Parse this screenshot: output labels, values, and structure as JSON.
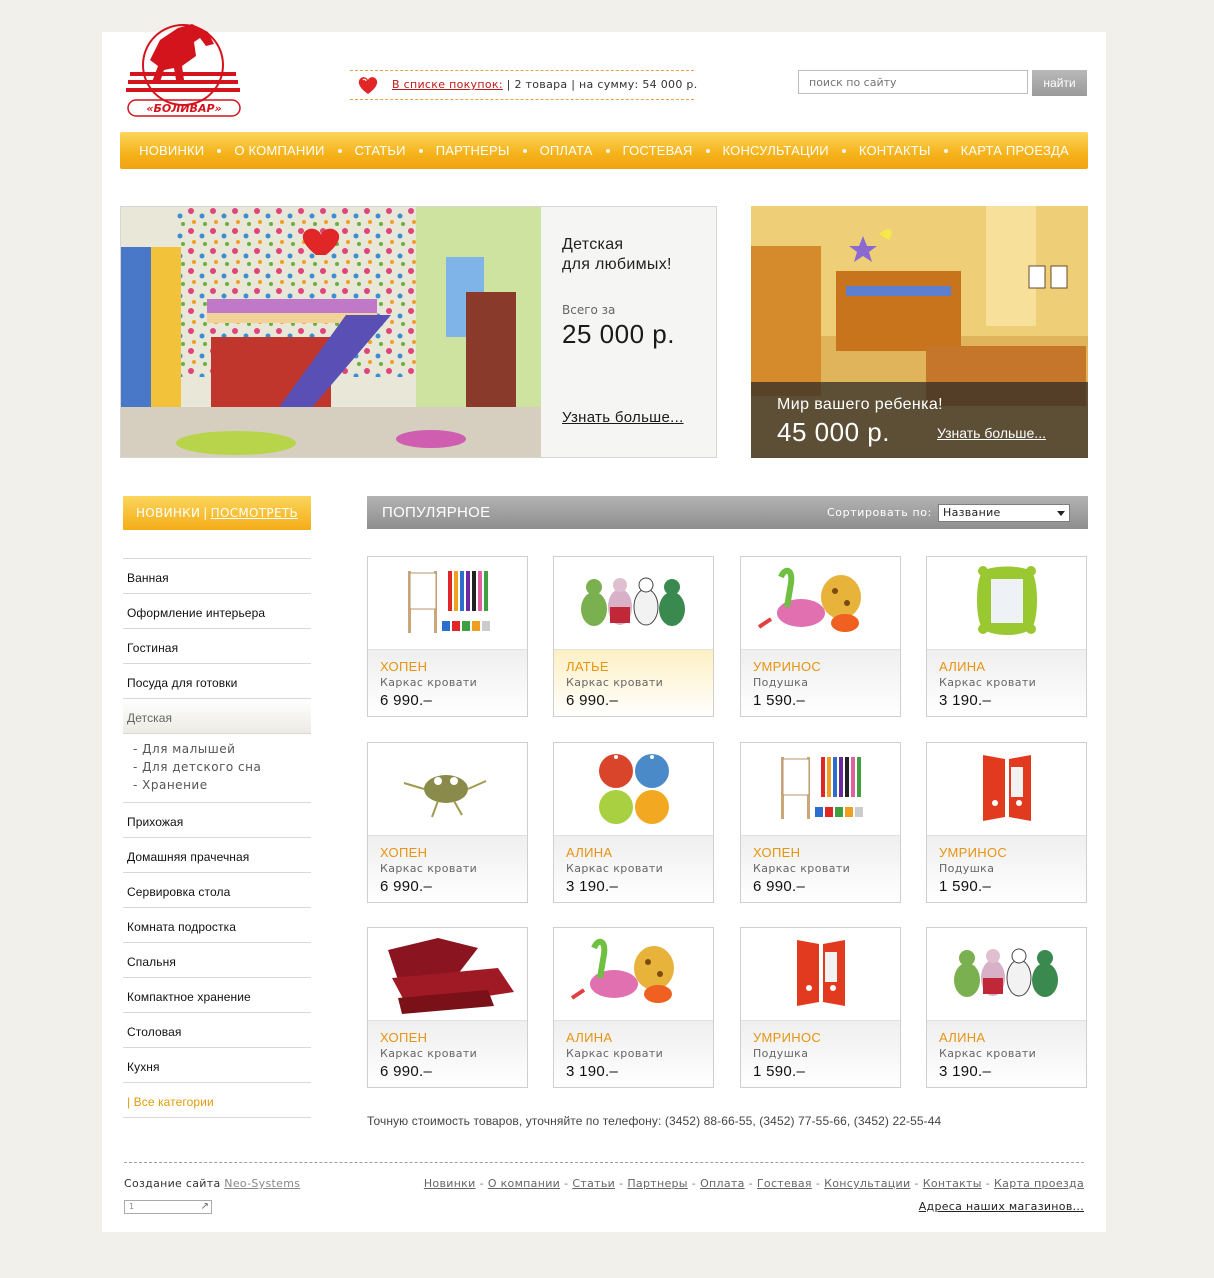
{
  "brand": {
    "logo_text": "«БОЛИВАР»"
  },
  "cart": {
    "link": "В списке покупок:",
    "sep1": " | ",
    "count": "2 товара",
    "sep2": " | ",
    "sum": "на сумму: 54 000 р."
  },
  "search": {
    "placeholder": "поиск по сайту",
    "button": "найти"
  },
  "nav": [
    "Новинки",
    "О компании",
    "Статьи",
    "Партнеры",
    "Оплата",
    "Гостевая",
    "Консультации",
    "Контакты",
    "Карта проезда"
  ],
  "banner1": {
    "title": "Детская\nдля любимых!",
    "total_label": "Всего за",
    "price": "25 000 р.",
    "more": "Узнать больше..."
  },
  "banner2": {
    "title": "Мир вашего ребенка!",
    "price": "45 000 р.",
    "more": "Узнать больше..."
  },
  "sidebar": {
    "new_label": "Новинки",
    "sep": "|",
    "see_label": "Посмотреть",
    "categories": [
      "Ванная",
      "Оформление интерьера",
      "Гостиная",
      "Посуда для готовки",
      "Детская"
    ],
    "subcategories": [
      "- Для малышей",
      "- Для детского сна",
      "- Хранение"
    ],
    "categories2": [
      "Прихожая",
      "Домашняя прачечная",
      "Сервировка стола",
      "Комната подростка",
      "Спальня",
      "Компактное хранение",
      "Столовая",
      "Кухня"
    ],
    "all": "| Все категории"
  },
  "popular": {
    "title": "Популярное",
    "sort_label": "Сортировать по:",
    "sort_value": "Название",
    "products": [
      {
        "name": "Хопен",
        "type": "Каркас кровати",
        "price": "6 990.–",
        "icon": "easel-markers-icon"
      },
      {
        "name": "Латье",
        "type": "Каркас кровати",
        "price": "6 990.–",
        "icon": "toy-animals-icon"
      },
      {
        "name": "Умринос",
        "type": "Подушка",
        "price": "1 590.–",
        "icon": "plush-toys-icon"
      },
      {
        "name": "Алина",
        "type": "Каркас кровати",
        "price": "3 190.–",
        "icon": "green-mirror-icon"
      },
      {
        "name": "Хопен",
        "type": "Каркас кровати",
        "price": "6 990.–",
        "icon": "frog-toy-icon"
      },
      {
        "name": "Алина",
        "type": "Каркас кровати",
        "price": "3 190.–",
        "icon": "color-circles-icon"
      },
      {
        "name": "Хопен",
        "type": "Каркас кровати",
        "price": "6 990.–",
        "icon": "easel-markers-icon"
      },
      {
        "name": "Умринос",
        "type": "Подушка",
        "price": "1 590.–",
        "icon": "red-cabinet-icon"
      },
      {
        "name": "Хопен",
        "type": "Каркас кровати",
        "price": "6 990.–",
        "icon": "red-pillows-icon"
      },
      {
        "name": "Алина",
        "type": "Каркас кровати",
        "price": "3 190.–",
        "icon": "plush-toys-icon"
      },
      {
        "name": "Умринос",
        "type": "Подушка",
        "price": "1 590.–",
        "icon": "red-cabinet-icon"
      },
      {
        "name": "Алина",
        "type": "Каркас кровати",
        "price": "3 190.–",
        "icon": "toy-animals-icon"
      }
    ]
  },
  "phone_note": "Точную стоимость товаров, уточняйте по телефону: (3452) 88-66-55, (3452) 77-55-66, (3452) 22-55-44",
  "footer": {
    "credit": "Создание сайта",
    "credit_link": "Neo-Systems",
    "counter": "1",
    "links": [
      "Новинки",
      "О компании",
      "Статьи",
      "Партнеры",
      "Оплата",
      "Гостевая",
      "Консультации",
      "Контакты",
      "Карта проезда"
    ],
    "addresses": "Адреса наших магазинов..."
  },
  "colors": {
    "accent": "#f5b21a",
    "price_name": "#e79410",
    "bg": "#f1f0ea",
    "logo_red": "#d4141c"
  }
}
